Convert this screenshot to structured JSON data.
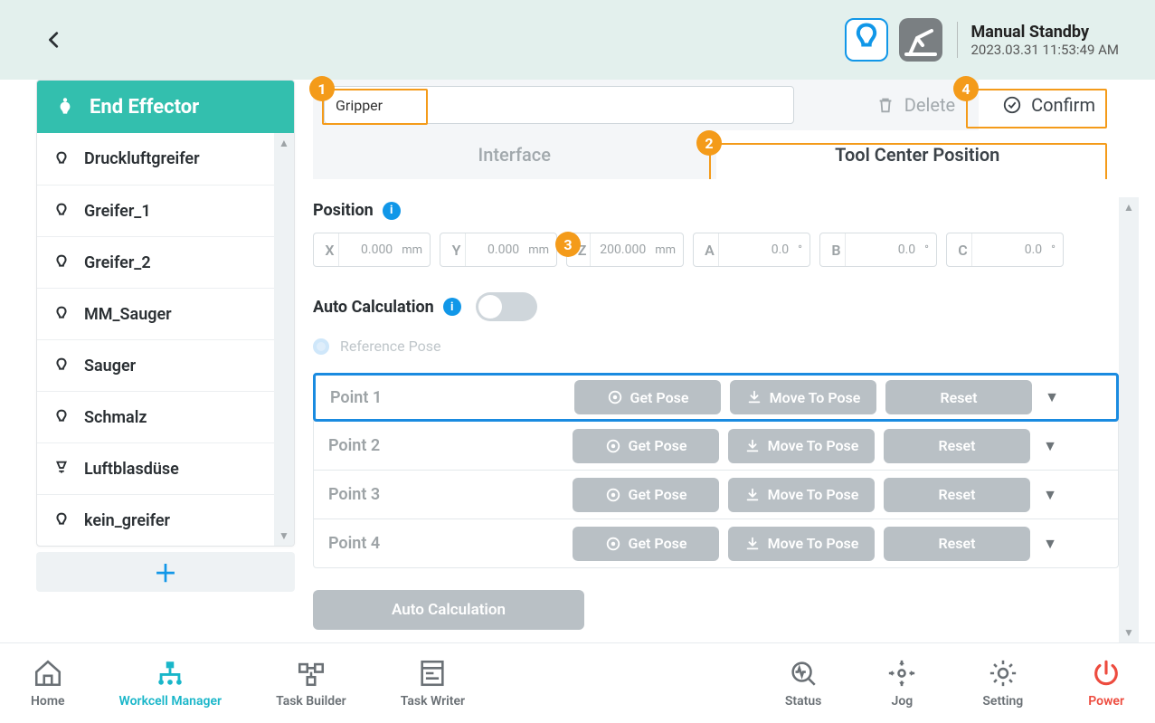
{
  "status": {
    "mode": "Manual Standby",
    "datetime": "2023.03.31 11:53:49 AM"
  },
  "sidebar": {
    "title": "End Effector",
    "items": [
      {
        "label": "Druckluftgreifer",
        "icon": "gripper"
      },
      {
        "label": "Greifer_1",
        "icon": "gripper"
      },
      {
        "label": "Greifer_2",
        "icon": "gripper"
      },
      {
        "label": "MM_Sauger",
        "icon": "gripper"
      },
      {
        "label": "Sauger",
        "icon": "gripper"
      },
      {
        "label": "Schmalz",
        "icon": "gripper"
      },
      {
        "label": "Luftblasdüse",
        "icon": "nozzle"
      },
      {
        "label": "kein_greifer",
        "icon": "gripper"
      }
    ]
  },
  "editor": {
    "name": "Gripper",
    "actions": {
      "delete": "Delete",
      "confirm": "Confirm"
    },
    "tabs": {
      "interface": "Interface",
      "tcp": "Tool Center Position"
    },
    "position": {
      "label": "Position",
      "fields": [
        {
          "axis": "X",
          "value": "0.000",
          "unit": "mm"
        },
        {
          "axis": "Y",
          "value": "0.000",
          "unit": "mm"
        },
        {
          "axis": "Z",
          "value": "200.000",
          "unit": "mm"
        },
        {
          "axis": "A",
          "value": "0.0",
          "unit": "°"
        },
        {
          "axis": "B",
          "value": "0.0",
          "unit": "°"
        },
        {
          "axis": "C",
          "value": "0.0",
          "unit": "°"
        }
      ]
    },
    "autocalc": {
      "label": "Auto Calculation",
      "enabled": false
    },
    "reference_pose": "Reference Pose",
    "points": [
      {
        "label": "Point 1"
      },
      {
        "label": "Point 2"
      },
      {
        "label": "Point 3"
      },
      {
        "label": "Point 4"
      }
    ],
    "point_buttons": {
      "get": "Get Pose",
      "move": "Move To Pose",
      "reset": "Reset"
    },
    "autocalc_button": "Auto Calculation"
  },
  "callouts": {
    "1": "1",
    "2": "2",
    "3": "3",
    "4": "4"
  },
  "bottomnav": {
    "home": "Home",
    "workcell": "Workcell Manager",
    "taskbuilder": "Task Builder",
    "taskwriter": "Task Writer",
    "status": "Status",
    "jog": "Jog",
    "setting": "Setting",
    "power": "Power"
  }
}
